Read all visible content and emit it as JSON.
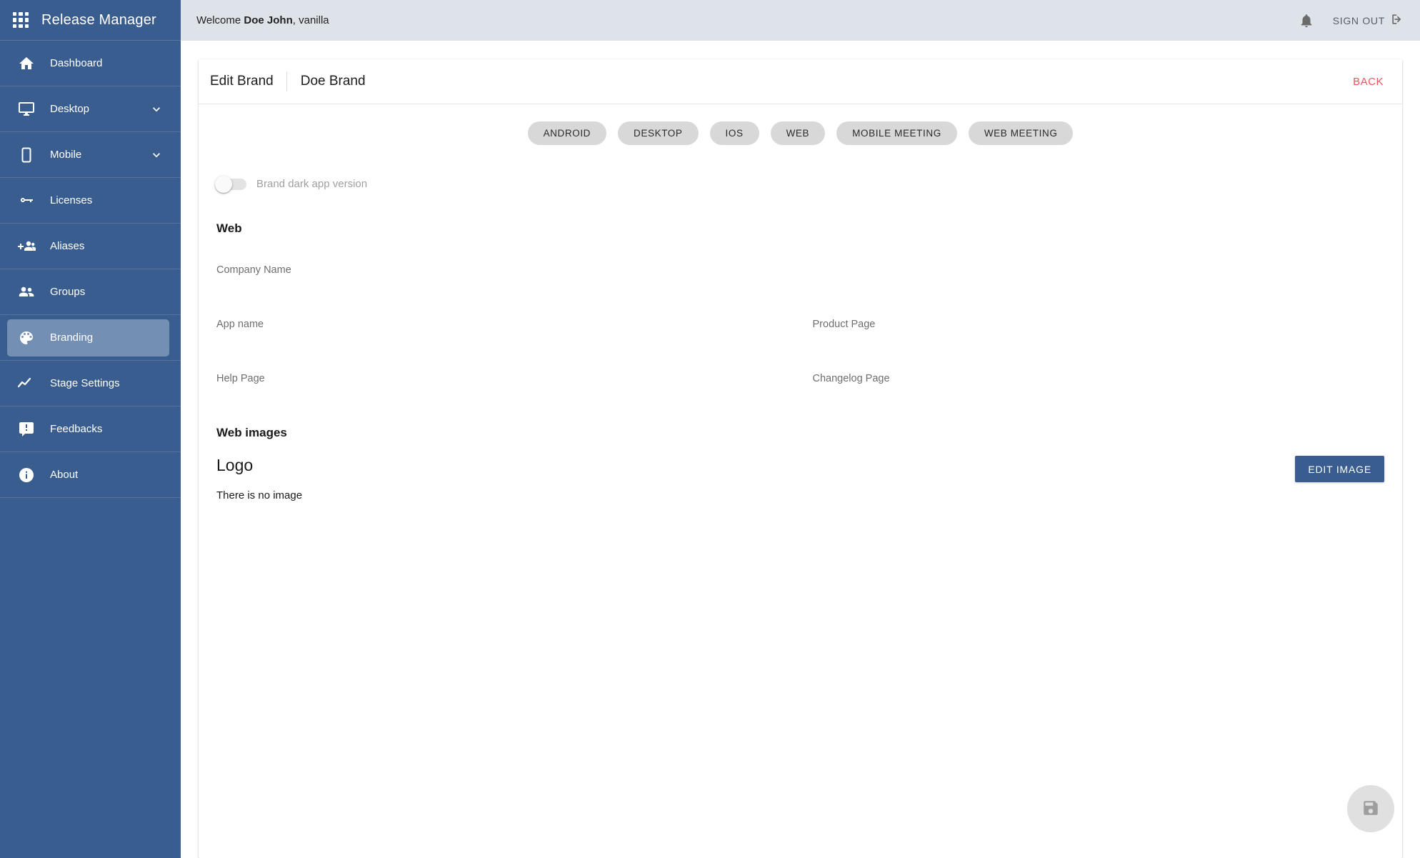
{
  "sidebar": {
    "brand_title": "Release Manager",
    "apps_icon": "apps-grid-icon",
    "items": [
      {
        "label": "Dashboard",
        "icon": "home-icon",
        "expandable": false,
        "active": false
      },
      {
        "label": "Desktop",
        "icon": "monitor-icon",
        "expandable": true,
        "active": false
      },
      {
        "label": "Mobile",
        "icon": "smartphone-icon",
        "expandable": true,
        "active": false
      },
      {
        "label": "Licenses",
        "icon": "key-icon",
        "expandable": false,
        "active": false
      },
      {
        "label": "Aliases",
        "icon": "person-add-icon",
        "expandable": false,
        "active": false
      },
      {
        "label": "Groups",
        "icon": "people-icon",
        "expandable": false,
        "active": false
      },
      {
        "label": "Branding",
        "icon": "palette-icon",
        "expandable": false,
        "active": true
      },
      {
        "label": "Stage Settings",
        "icon": "trending-up-icon",
        "expandable": false,
        "active": false
      },
      {
        "label": "Feedbacks",
        "icon": "feedback-icon",
        "expandable": false,
        "active": false
      },
      {
        "label": "About",
        "icon": "info-icon",
        "expandable": false,
        "active": false
      }
    ]
  },
  "topbar": {
    "welcome_prefix": "Welcome ",
    "user_name": "Doe John",
    "welcome_suffix": ", vanilla",
    "notifications_icon": "bell-icon",
    "sign_out_label": "SIGN OUT",
    "sign_out_icon": "exit-to-app-icon"
  },
  "card": {
    "breadcrumb_main": "Edit Brand",
    "breadcrumb_sub": "Doe Brand",
    "back_label": "BACK"
  },
  "platform_chips": [
    {
      "label": "ANDROID"
    },
    {
      "label": "DESKTOP"
    },
    {
      "label": "IOS"
    },
    {
      "label": "WEB"
    },
    {
      "label": "MOBILE MEETING"
    },
    {
      "label": "WEB MEETING"
    }
  ],
  "dark_toggle": {
    "label": "Brand dark app version",
    "checked": false
  },
  "web_section": {
    "heading": "Web",
    "fields": [
      {
        "label": "Company Name",
        "value": "",
        "span": "full"
      },
      {
        "label": "App name",
        "value": "",
        "span": "half"
      },
      {
        "label": "Product Page",
        "value": "",
        "span": "half"
      },
      {
        "label": "Help Page",
        "value": "",
        "span": "half"
      },
      {
        "label": "Changelog Page",
        "value": "",
        "span": "half"
      }
    ]
  },
  "web_images": {
    "heading": "Web images",
    "logo_title": "Logo",
    "empty_text": "There is no image",
    "edit_image_label": "EDIT IMAGE"
  },
  "fab": {
    "icon": "save-icon"
  },
  "colors": {
    "sidebar_blue": "#3a5d8f",
    "sidebar_active": "#7390b4",
    "topbar_grey": "#dee3ea",
    "back_red": "#f4525f",
    "chip_grey": "#d8d8d8",
    "button_blue": "#3a5d8f",
    "fab_grey": "#e0e0e0"
  }
}
